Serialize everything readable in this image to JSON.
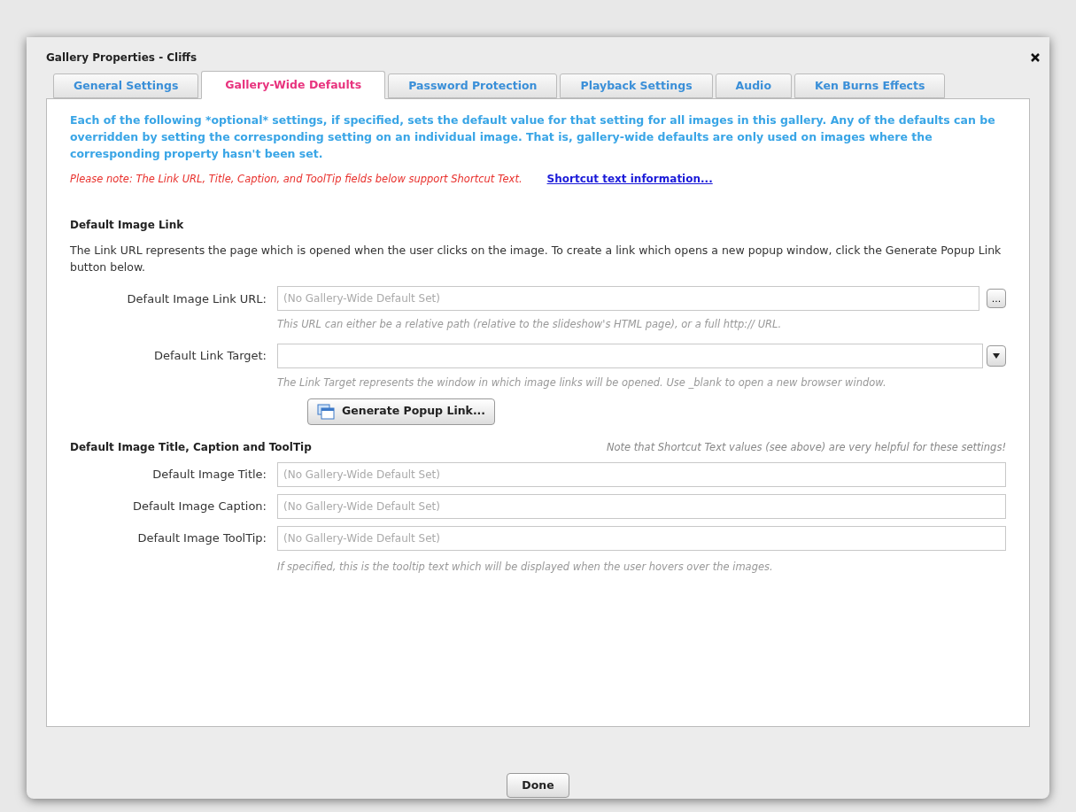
{
  "window": {
    "title": "Gallery Properties - Cliffs"
  },
  "tabs": [
    {
      "label": "General Settings",
      "selected": false
    },
    {
      "label": "Gallery-Wide Defaults",
      "selected": true
    },
    {
      "label": "Password Protection",
      "selected": false
    },
    {
      "label": "Playback Settings",
      "selected": false
    },
    {
      "label": "Audio",
      "selected": false
    },
    {
      "label": "Ken Burns Effects",
      "selected": false
    }
  ],
  "intro": "Each of the following *optional* settings, if specified, sets the default value for that setting for all images in this gallery.  Any of the defaults can be overridden by setting the corresponding setting on an individual image.  That is, gallery-wide defaults are only used on images where the corresponding property hasn't been set.",
  "note": {
    "text": "Please note: The Link URL, Title, Caption, and ToolTip fields below support Shortcut Text.",
    "link": "Shortcut text information..."
  },
  "link_section": {
    "heading": "Default Image Link",
    "description": "The Link URL represents the page which is opened when the user clicks on the image.  To create a link which opens a new popup window, click the Generate Popup Link button below.",
    "url": {
      "label": "Default Image Link URL:",
      "placeholder": "(No Gallery-Wide Default Set)",
      "button": "...",
      "hint": "This URL can either be a relative path (relative to the slideshow's HTML page), or a full http:// URL."
    },
    "target": {
      "label": "Default Link Target:",
      "hint": "The Link Target represents the window in which image links will be opened.  Use _blank to open a new browser window."
    },
    "popup_button": "Generate Popup Link..."
  },
  "text_section": {
    "heading": "Default Image Title, Caption and ToolTip",
    "note": "Note that Shortcut Text values (see above) are very helpful for these settings!",
    "fields": [
      {
        "label": "Default Image Title:",
        "placeholder": "(No Gallery-Wide Default Set)"
      },
      {
        "label": "Default Image Caption:",
        "placeholder": "(No Gallery-Wide Default Set)"
      },
      {
        "label": "Default Image ToolTip:",
        "placeholder": "(No Gallery-Wide Default Set)"
      }
    ],
    "hint": "If specified, this is the tooltip text which will be displayed when the user hovers over the images."
  },
  "done_button": "Done"
}
